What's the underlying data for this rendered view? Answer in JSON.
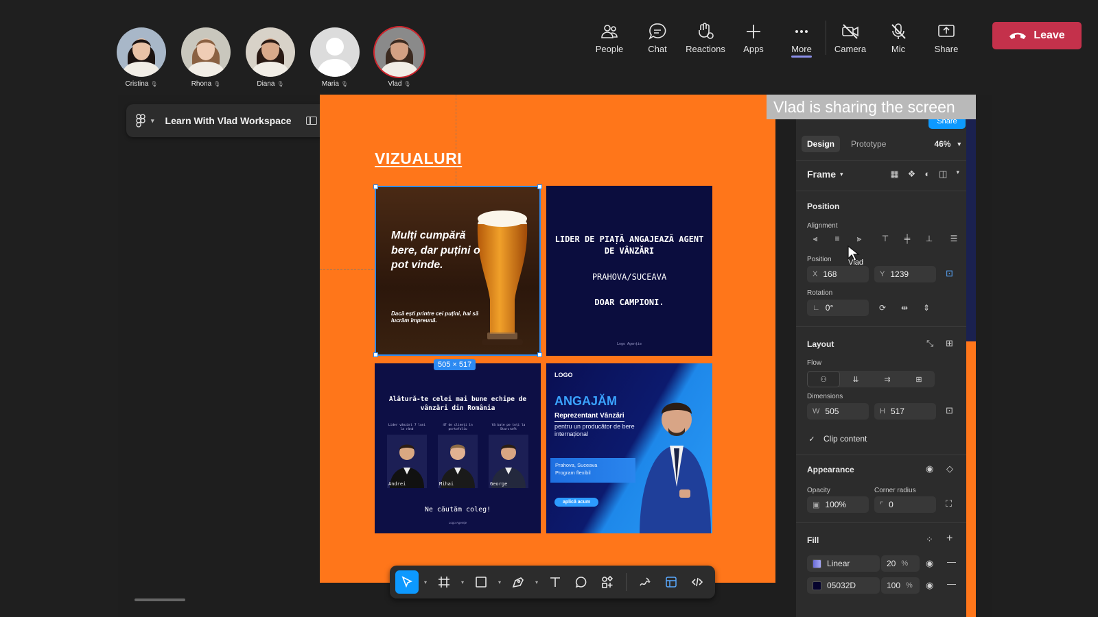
{
  "participants": [
    {
      "name": "Cristina",
      "skin": "#e9c2a6",
      "hair": "#1c1311",
      "bg": "#a8b7c8"
    },
    {
      "name": "Rhona",
      "skin": "#efcdb5",
      "hair": "#8a6142",
      "bg": "#c9c7bd"
    },
    {
      "name": "Diana",
      "skin": "#d9a98a",
      "hair": "#2a1a14",
      "bg": "#d8d2c8"
    },
    {
      "name": "Maria",
      "skin": "",
      "hair": "",
      "bg": "#dcdcdc"
    },
    {
      "name": "Vlad",
      "skin": "#d3a184",
      "hair": "#3b2a20",
      "bg": "#8a8a8a"
    }
  ],
  "toolbar": {
    "people": "People",
    "chat": "Chat",
    "reactions": "Reactions",
    "apps": "Apps",
    "more": "More",
    "camera": "Camera",
    "mic": "Mic",
    "share": "Share",
    "leave": "Leave"
  },
  "workspace": {
    "name": "Learn With Vlad Workspace"
  },
  "banner": "Vlad is sharing the screen",
  "share_stub": "Share",
  "canvas": {
    "title": "VIZUALURI",
    "selection_size": "505 × 517",
    "card1": {
      "headline": "Mulți cumpără bere, dar puțini o pot vinde.",
      "sub": "Dacă ești printre cei puțini, hai să lucrăm împreună."
    },
    "card2": {
      "headline": "LIDER DE PIAȚĂ ANGAJEAZĂ AGENT DE VÂNZĂRI",
      "location": "PRAHOVA/SUCEAVA",
      "strong": "DOAR CAMPIONI.",
      "logo": "Logo Agenție"
    },
    "card3": {
      "headline": "Alătură-te celei mai bune echipe de vânzări din România",
      "people": [
        {
          "tag": "Lider vânzări 7 luni la rând",
          "name": "Andrei"
        },
        {
          "tag": "47 de clienți în portofoliu",
          "name": "Mihai"
        },
        {
          "tag": "Vă bate pe toți la Starcraft",
          "name": "George"
        }
      ],
      "footer": "Ne căutăm coleg!",
      "logo": "Logo Agenție"
    },
    "card4": {
      "logo": "LOGO",
      "title": "ANGAJĂM",
      "role": "Reprezentant Vânzări",
      "desc": "pentru un producător de bere internațional",
      "box_line1": "Prahova, Suceava",
      "box_line2": "Program flexibil",
      "cta": "aplică acum"
    }
  },
  "panel": {
    "tab_design": "Design",
    "tab_prototype": "Prototype",
    "zoom": "46%",
    "frame_label": "Frame",
    "position_title": "Position",
    "alignment_label": "Alignment",
    "position_label": "Position",
    "x_key": "X",
    "x_val": "168",
    "y_key": "Y",
    "y_val": "1239",
    "rotation_label": "Rotation",
    "rotation_val": "0°",
    "layout_title": "Layout",
    "flow_label": "Flow",
    "dimensions_label": "Dimensions",
    "w_key": "W",
    "w_val": "505",
    "h_key": "H",
    "h_val": "517",
    "clip_label": "Clip content",
    "appearance_title": "Appearance",
    "opacity_label": "Opacity",
    "opacity_val": "100%",
    "radius_label": "Corner radius",
    "radius_val": "0",
    "fill_title": "Fill",
    "fills": [
      {
        "name": "Linear",
        "pct": "20",
        "unit": "%",
        "color": "#6a6cd8"
      },
      {
        "name": "05032D",
        "pct": "100",
        "unit": "%",
        "color": "#05032D"
      }
    ]
  },
  "cursor_label": "Vlad",
  "help": "?",
  "colors": {
    "frame": "#ff761a",
    "accent": "#0d99ff",
    "leave": "#c4314b"
  }
}
